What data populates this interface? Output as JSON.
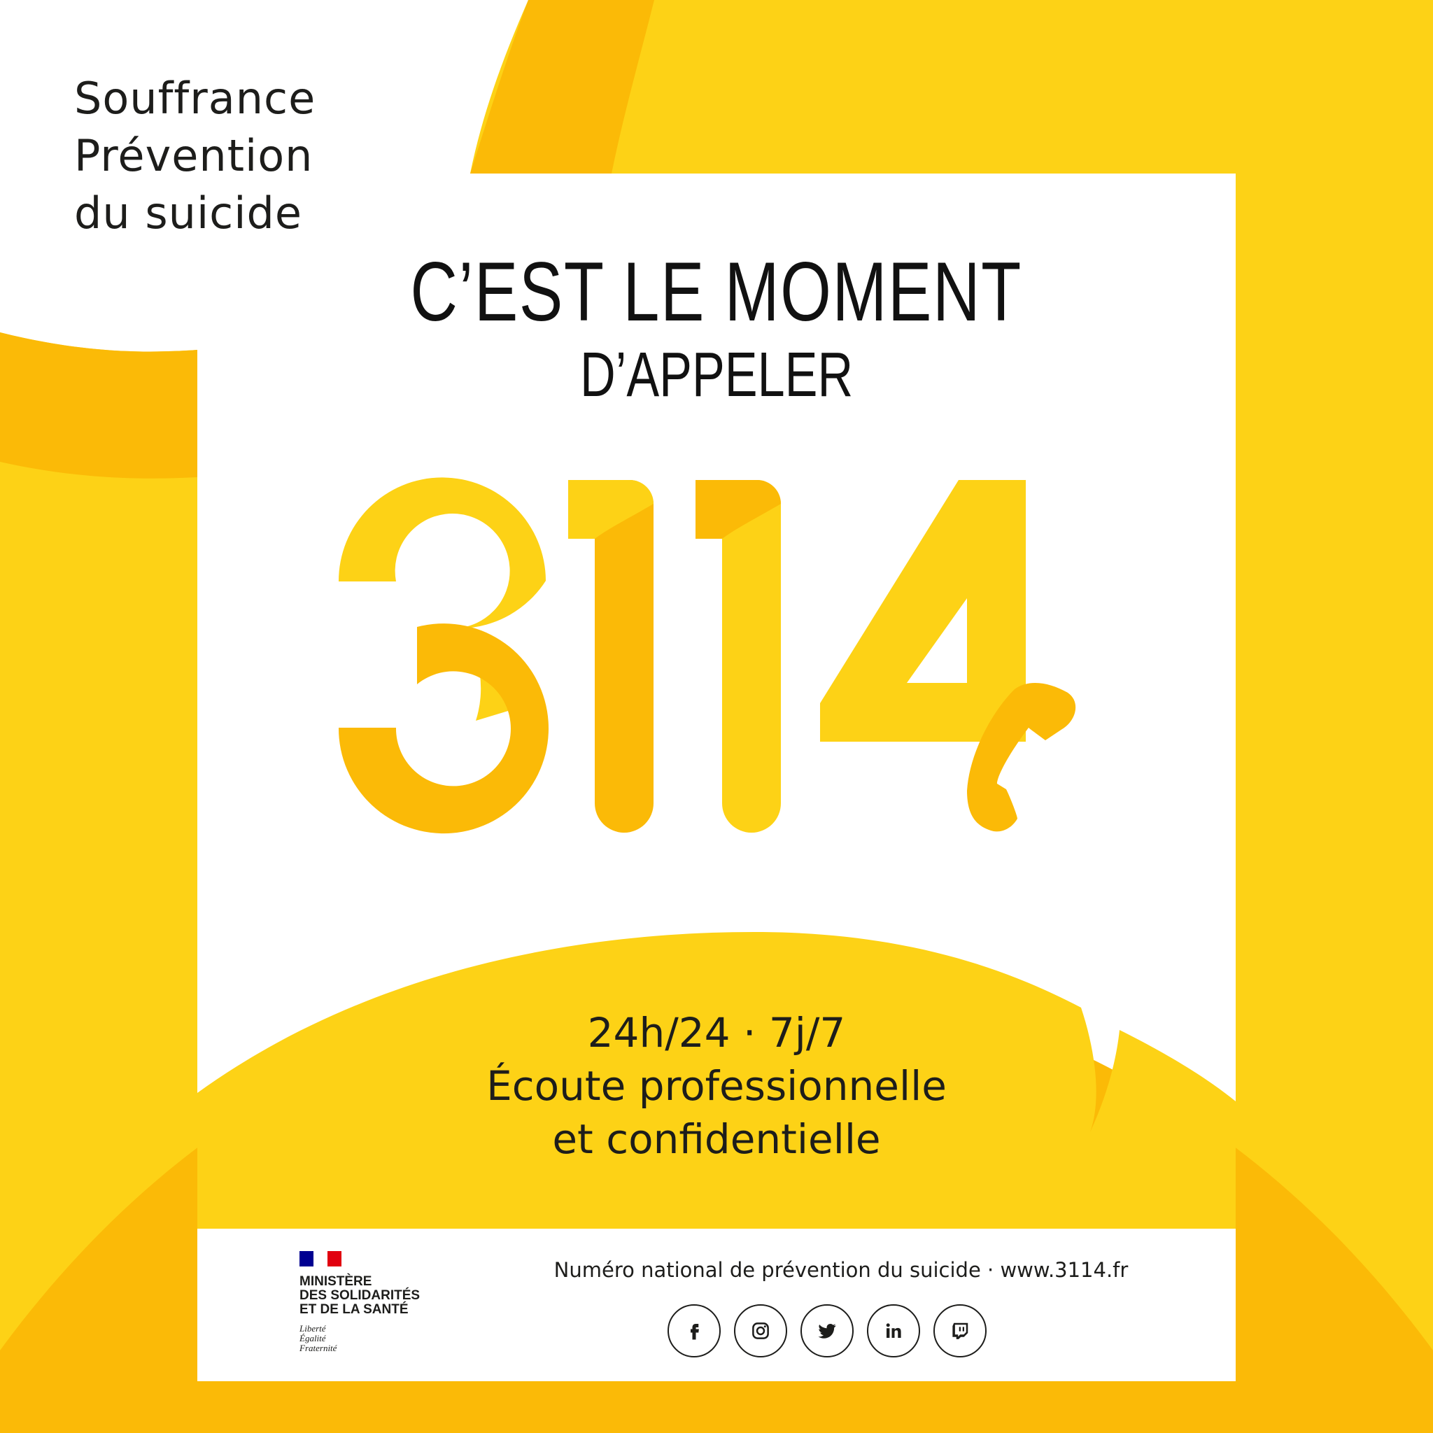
{
  "tagline": [
    "Souffrance",
    "Prévention",
    "du suicide"
  ],
  "headline": {
    "line1": "C’EST LE MOMENT",
    "line2": "D’APPELER"
  },
  "number": "3114",
  "info": {
    "hours": "24h/24 · 7j/7",
    "line1": "Écoute professionnelle",
    "line2": "et confidentielle"
  },
  "footer": {
    "ministry": [
      "MINISTÈRE",
      "DES SOLIDARITÉS",
      "ET DE LA SANTÉ"
    ],
    "motto": [
      "Liberté",
      "Égalité",
      "Fraternité"
    ],
    "text": "Numéro national de prévention du suicide · www.3114.fr",
    "socials": [
      {
        "name": "facebook",
        "icon": "facebook-icon"
      },
      {
        "name": "instagram",
        "icon": "instagram-icon"
      },
      {
        "name": "twitter",
        "icon": "twitter-icon"
      },
      {
        "name": "linkedin",
        "icon": "linkedin-icon"
      },
      {
        "name": "twitch",
        "icon": "twitch-icon"
      }
    ]
  },
  "colors": {
    "yellow": "#FDD216",
    "dark_yellow": "#FBBA07",
    "text": "#1D1D1B",
    "flag_blue": "#000091",
    "flag_red": "#E1000F"
  }
}
